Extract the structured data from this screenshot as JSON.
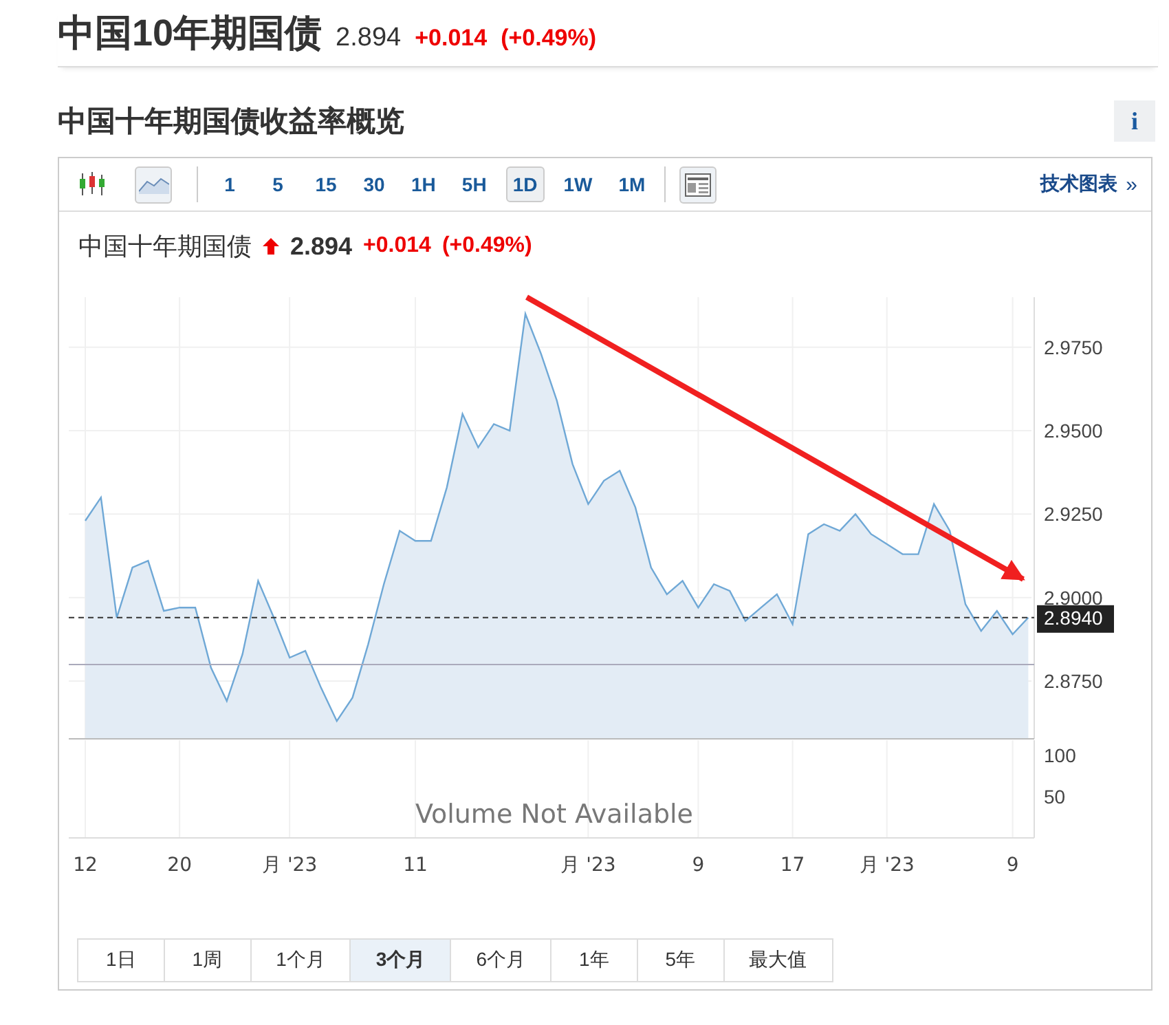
{
  "header": {
    "title": "中国10年期国债",
    "price": "2.894",
    "change": "+0.014",
    "change_pct": "(+0.49%)"
  },
  "section": {
    "title": "中国十年期国债收益率概览",
    "info_button": "i"
  },
  "toolbar": {
    "chart_types": [
      {
        "kind": "candlestick",
        "selected": false
      },
      {
        "kind": "area",
        "selected": true
      }
    ],
    "intervals": [
      {
        "label": "1",
        "selected": false
      },
      {
        "label": "5",
        "selected": false
      },
      {
        "label": "15",
        "selected": false
      },
      {
        "label": "30",
        "selected": false
      },
      {
        "label": "1H",
        "selected": false
      },
      {
        "label": "5H",
        "selected": false
      },
      {
        "label": "1D",
        "selected": true
      },
      {
        "label": "1W",
        "selected": false
      },
      {
        "label": "1M",
        "selected": false
      }
    ],
    "tech_chart_link": "技术图表",
    "link_chevron": "»"
  },
  "quote": {
    "name": "中国十年期国债",
    "rising": true,
    "price": "2.894",
    "change": "+0.014",
    "change_pct": "(+0.49%)"
  },
  "chart": {
    "last_price_label": "2.8940",
    "volume_ticks": [
      "100",
      "50"
    ],
    "volume_message": "Volume Not Available",
    "chart_data": {
      "type": "area",
      "grid": true,
      "ylim": [
        2.828,
        2.99
      ],
      "categories": [
        "12",
        null,
        null,
        null,
        null,
        null,
        "20",
        null,
        null,
        null,
        null,
        null,
        null,
        "月 '23",
        null,
        null,
        null,
        null,
        null,
        null,
        null,
        "11",
        null,
        null,
        null,
        null,
        null,
        null,
        null,
        null,
        null,
        null,
        "月 '23",
        null,
        null,
        null,
        null,
        null,
        null,
        "9",
        null,
        null,
        null,
        null,
        null,
        "17",
        null,
        null,
        null,
        null,
        null,
        "月 '23",
        null,
        null,
        null,
        null,
        null,
        null,
        null,
        "9",
        null
      ],
      "series": [
        {
          "color": "#6fa8d6",
          "values": [
            2.923,
            2.93,
            2.894,
            2.909,
            2.911,
            2.896,
            2.897,
            2.897,
            2.879,
            2.869,
            2.883,
            2.905,
            2.894,
            2.882,
            2.884,
            2.873,
            2.863,
            2.87,
            2.886,
            2.904,
            2.92,
            2.917,
            2.917,
            2.933,
            2.955,
            2.945,
            2.952,
            2.95,
            2.985,
            2.973,
            2.959,
            2.94,
            2.928,
            2.935,
            2.938,
            2.927,
            2.909,
            2.901,
            2.905,
            2.897,
            2.904,
            2.902,
            2.893,
            2.897,
            2.901,
            2.892,
            2.919,
            2.922,
            2.92,
            2.925,
            2.919,
            2.916,
            2.913,
            2.913,
            2.928,
            2.92,
            2.898,
            2.89,
            2.896,
            2.889,
            2.894
          ]
        }
      ],
      "yticks": [
        {
          "value": 2.975,
          "label": "2.9750"
        },
        {
          "value": 2.95,
          "label": "2.9500"
        },
        {
          "value": 2.925,
          "label": "2.9250"
        },
        {
          "value": 2.9,
          "label": "2.9000"
        },
        {
          "value": 2.875,
          "label": "2.8750"
        }
      ]
    }
  },
  "ranges": [
    {
      "label": "1日",
      "selected": false
    },
    {
      "label": "1周",
      "selected": false
    },
    {
      "label": "1个月",
      "selected": false
    },
    {
      "label": "3个月",
      "selected": true
    },
    {
      "label": "6个月",
      "selected": false
    },
    {
      "label": "1年",
      "selected": false
    },
    {
      "label": "5年",
      "selected": false
    },
    {
      "label": "最大值",
      "selected": false
    }
  ]
}
